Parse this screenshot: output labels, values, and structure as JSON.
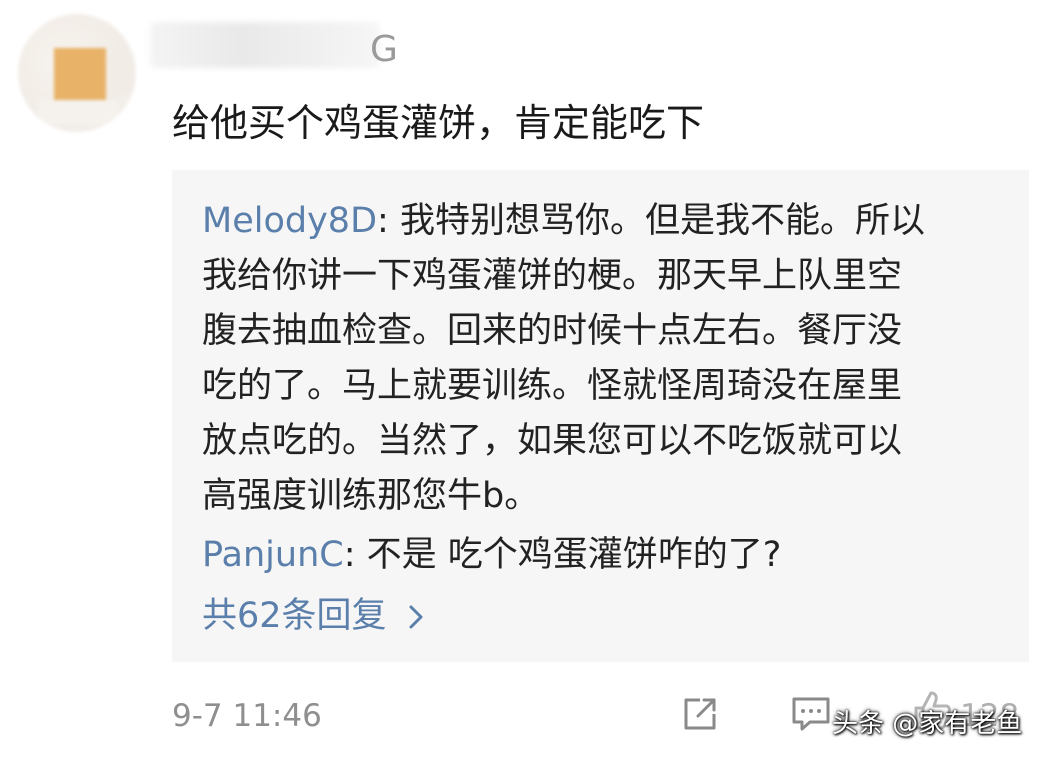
{
  "comment": {
    "author_partial": "G",
    "text": "给他买个鸡蛋灌饼，肯定能吃下",
    "timestamp": "9-7 11:46",
    "like_count": "128"
  },
  "replies": [
    {
      "author": "Melody8D",
      "separator": ": ",
      "lines": [
        "我特别想骂你。但是我不能。所以",
        "我给你讲一下鸡蛋灌饼的梗。那天早上队里空",
        "腹去抽血检查。回来的时候十点左右。餐厅没",
        "吃的了。马上就要训练。怪就怪周琦没在屋里",
        "放点吃的。当然了，如果您可以不吃饭就可以",
        "高强度训练那您牛b。"
      ]
    },
    {
      "author": "PanjunC",
      "separator": ": ",
      "lines": [
        "不是 吃个鸡蛋灌饼咋的了?"
      ]
    }
  ],
  "more_replies_label": "共62条回复",
  "icons": {
    "share": "share-icon",
    "comment": "comment-icon",
    "like": "thumbs-up-icon",
    "more": "chevron-right-icon"
  },
  "colors": {
    "link_blue": "#5b7fab",
    "reply_bg": "#f6f6f6",
    "meta_gray": "#8f8f8f"
  },
  "watermark": "头条 @家有老鱼"
}
